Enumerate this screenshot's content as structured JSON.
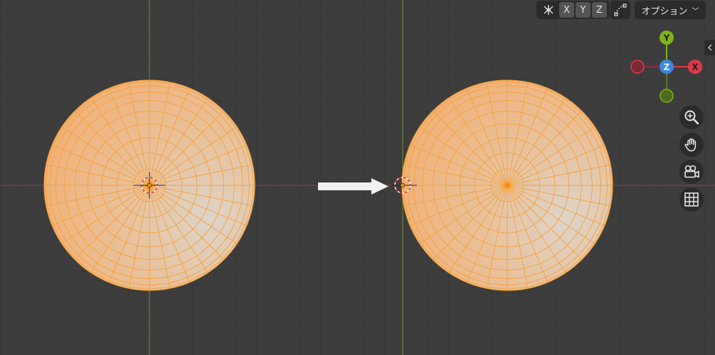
{
  "header": {
    "mirror_axes": [
      "X",
      "Y",
      "Z"
    ],
    "options_label": "オプション",
    "options_chevron": "﹀"
  },
  "gizmo": {
    "pos_y": "Y",
    "pos_z": "Z",
    "pos_x": "X",
    "colors": {
      "x": "#e0384b",
      "y": "#7fb31a",
      "z": "#3a87e0"
    }
  },
  "icons": {
    "mirror": "mirror-icon",
    "snap": "snap-icon",
    "zoom": "zoom-icon",
    "pan": "hand-icon",
    "camera": "camera-icon",
    "grid": "grid-icon",
    "collapse": "chevron-left-icon"
  },
  "colors": {
    "background": "#3d3d3d",
    "grid": "#333333",
    "x_axis": "#9b3a3a",
    "y_axis": "#6d8d2a",
    "selection": "#f5a13a"
  }
}
